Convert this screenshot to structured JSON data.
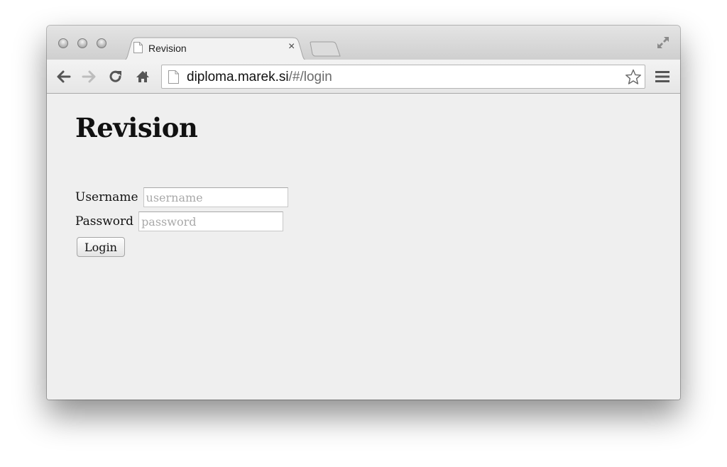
{
  "browser": {
    "tab": {
      "title": "Revision",
      "close_glyph": "×"
    },
    "address_bar": {
      "host": "diploma.marek.si",
      "path": "/#/login"
    },
    "icons": {
      "traffic_lights": [
        "close-light",
        "minimize-light",
        "zoom-light"
      ],
      "tab_favicon": "page-icon",
      "new_tab": "new-tab-icon",
      "fullscreen": "fullscreen-icon",
      "back": "back-arrow-icon",
      "forward": "forward-arrow-icon",
      "reload": "reload-icon",
      "home": "home-icon",
      "bookmark": "star-icon",
      "menu": "hamburger-menu-icon"
    }
  },
  "page": {
    "title": "Revision",
    "form": {
      "username_label": "Username",
      "username_placeholder": "username",
      "username_value": "",
      "password_label": "Password",
      "password_placeholder": "password",
      "password_value": "",
      "login_button": "Login"
    }
  }
}
